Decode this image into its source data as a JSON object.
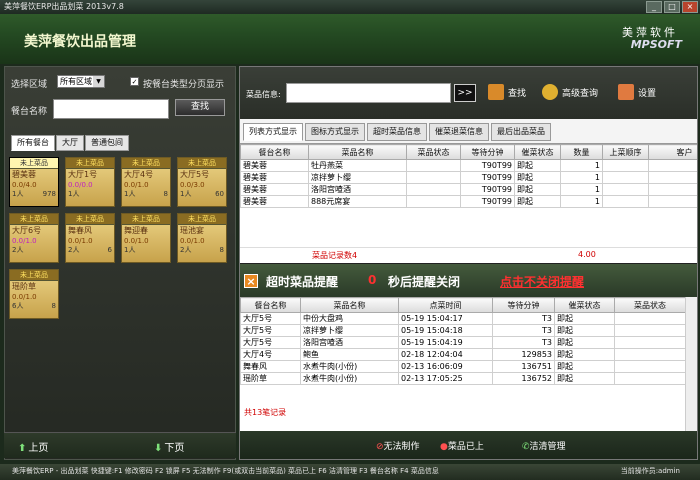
{
  "window": {
    "title": "美萍餐饮ERP出品划菜 2013v7.8",
    "buttons": [
      "_",
      "□",
      "×"
    ]
  },
  "header": {
    "app_title": "美萍餐饮出品管理",
    "brand_cn": "美萍软件",
    "brand_en": "MPSOFT"
  },
  "left": {
    "region_label": "选择区域",
    "region_value": "所有区域",
    "paging_checkbox_label": "按餐台类型分页显示",
    "paging_checked": true,
    "name_label": "餐台名称",
    "find_button": "查找",
    "tabs": [
      "所有餐台",
      "大厅",
      "普通包间"
    ],
    "active_tab": 0,
    "tiles": [
      {
        "tag": "未上菜品",
        "name": "碧美蓉",
        "stat": "0.0/4.0",
        "people": "1人",
        "rn": "978",
        "active": true,
        "pink": false
      },
      {
        "tag": "未上菜品",
        "name": "大厅1号",
        "stat": "0.0/0.0",
        "people": "1人",
        "rn": "",
        "active": false,
        "pink": true
      },
      {
        "tag": "未上菜品",
        "name": "大厅4号",
        "stat": "0.0/1.0",
        "people": "1人",
        "rn": "8",
        "active": false,
        "pink": false
      },
      {
        "tag": "未上菜品",
        "name": "大厅5号",
        "stat": "0.0/3.0",
        "people": "1人",
        "rn": "60",
        "active": false,
        "pink": false
      },
      {
        "tag": "未上菜品",
        "name": "大厅6号",
        "stat": "0.0/1.0",
        "people": "2人",
        "rn": "",
        "active": false,
        "pink": true
      },
      {
        "tag": "未上菜品",
        "name": "舞春风",
        "stat": "0.0/1.0",
        "people": "2人",
        "rn": "6",
        "active": false,
        "pink": false
      },
      {
        "tag": "未上菜品",
        "name": "舞迎春",
        "stat": "0.0/1.0",
        "people": "1人",
        "rn": "",
        "active": false,
        "pink": false
      },
      {
        "tag": "未上菜品",
        "name": "瑶池宴",
        "stat": "0.0/1.0",
        "people": "2人",
        "rn": "8",
        "active": false,
        "pink": false
      },
      {
        "tag": "未上菜品",
        "name": "瑶阶草",
        "stat": "0.0/1.0",
        "people": "6人",
        "rn": "8",
        "active": false,
        "pink": false
      }
    ],
    "prev_page": "上页",
    "next_page": "下页"
  },
  "right": {
    "dish_info_label": "菜品信息:",
    "go_button": ">>",
    "search_button": "查找",
    "advanced_button": "高级查询",
    "settings_button": "设置",
    "tabs": [
      "列表方式显示",
      "图标方式显示",
      "超时菜品信息",
      "催菜退菜信息",
      "最后出品菜品"
    ],
    "active_tab": 0,
    "grid1": {
      "columns": [
        "餐台名称",
        "菜品名称",
        "菜品状态",
        "等待分钟",
        "催菜状态",
        "数量",
        "上菜顺序",
        "客户"
      ],
      "rows": [
        [
          "碧美蓉",
          "牡丹燕菜",
          "",
          "T90T99",
          "即起",
          "1",
          "",
          ""
        ],
        [
          "碧美蓉",
          "凉拌萝卜缨",
          "",
          "T90T99",
          "即起",
          "1",
          "",
          ""
        ],
        [
          "碧美蓉",
          "洛阳宫喳酒",
          "",
          "T90T99",
          "即起",
          "1",
          "",
          ""
        ],
        [
          "碧美蓉",
          "888元席宴",
          "",
          "T90T99",
          "即起",
          "1",
          "",
          ""
        ]
      ],
      "summary_label": "菜品记录数4",
      "summary_total": "4.00"
    },
    "alert": {
      "text1": "超时菜品提醒",
      "countdown": "0",
      "text2": "秒后提醒关闭",
      "link": "点击不关闭提醒"
    },
    "grid2": {
      "columns": [
        "餐台名称",
        "菜品名称",
        "点菜时间",
        "等待分钟",
        "催菜状态",
        "菜品状态"
      ],
      "rows": [
        [
          "大厅5号",
          "中份大盘鸡",
          "05-19 15:04:17",
          "T3",
          "即起",
          ""
        ],
        [
          "大厅5号",
          "凉拌萝卜缨",
          "05-19 15:04:18",
          "T3",
          "即起",
          ""
        ],
        [
          "大厅5号",
          "洛阳宫喳酒",
          "05-19 15:04:19",
          "T3",
          "即起",
          ""
        ],
        [
          "大厅4号",
          "鲍鱼",
          "02-18 12:04:04",
          "129853",
          "即起",
          ""
        ],
        [
          "舞春风",
          "水煮牛肉(小份)",
          "02-13 16:06:09",
          "136751",
          "即起",
          ""
        ],
        [
          "瑶阶草",
          "水煮牛肉(小份)",
          "02-13 17:05:25",
          "136752",
          "即起",
          ""
        ]
      ],
      "summary": "共13笔记录"
    },
    "footer": {
      "cannot_make": "无法制作",
      "served": "菜品已上",
      "clean": "洁清管理"
    }
  },
  "statusbar": {
    "left": "美萍餐饮ERP - 出品划菜    快捷键:F1 修改密码  F2 锁屏  F5 无法制作  F9(或双击当前菜品) 菜品已上  F6 洁清管理  F3 餐台名称  F4 菜品信息",
    "operator": "当前操作员:admin"
  },
  "colors": {
    "header_green": "#244a22",
    "tile_gold": "#ecd487",
    "alert_red": "#ff3030"
  }
}
